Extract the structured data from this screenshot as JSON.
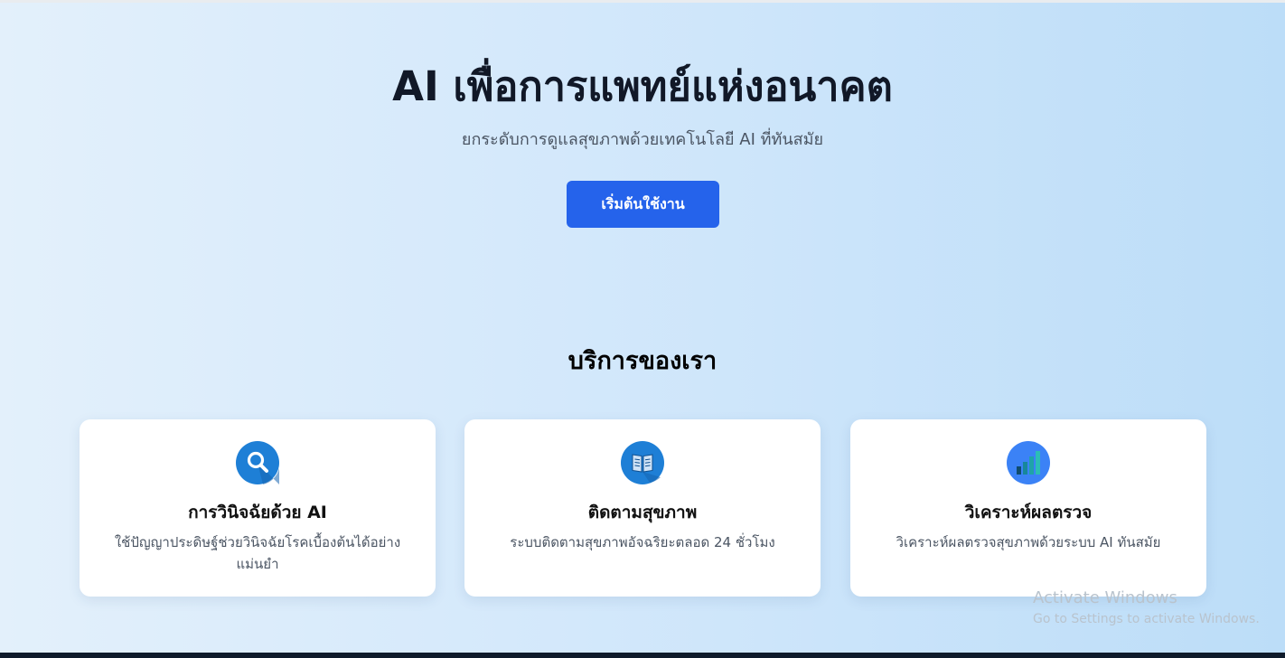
{
  "hero": {
    "title": "AI เพื่อการแพทย์แห่งอนาคต",
    "subtitle": "ยกระดับการดูแลสุขภาพด้วยเทคโนโลยี AI ที่ทันสมัย",
    "cta_label": "เริ่มต้นใช้งาน"
  },
  "services": {
    "title": "บริการของเรา",
    "cards": [
      {
        "icon": "magnifier-icon",
        "title": "การวินิจฉัยด้วย AI",
        "description": "ใช้ปัญญาประดิษฐ์ช่วยวินิจฉัยโรคเบื้องต้นได้อย่างแม่นยำ"
      },
      {
        "icon": "book-icon",
        "title": "ติดตามสุขภาพ",
        "description": "ระบบติดตามสุขภาพอัจฉริยะตลอด 24 ชั่วโมง"
      },
      {
        "icon": "bar-chart-icon",
        "title": "วิเคราะห์ผลตรวจ",
        "description": "วิเคราะห์ผลตรวจสุขภาพด้วยระบบ AI ทันสมัย"
      }
    ]
  },
  "watermark": {
    "title": "Activate Windows",
    "subtitle": "Go to Settings to activate Windows."
  },
  "colors": {
    "accent": "#2563eb",
    "icon_blue": "#1e7fd6",
    "background_start": "#e3f0fb",
    "background_end": "#bcddf8"
  }
}
